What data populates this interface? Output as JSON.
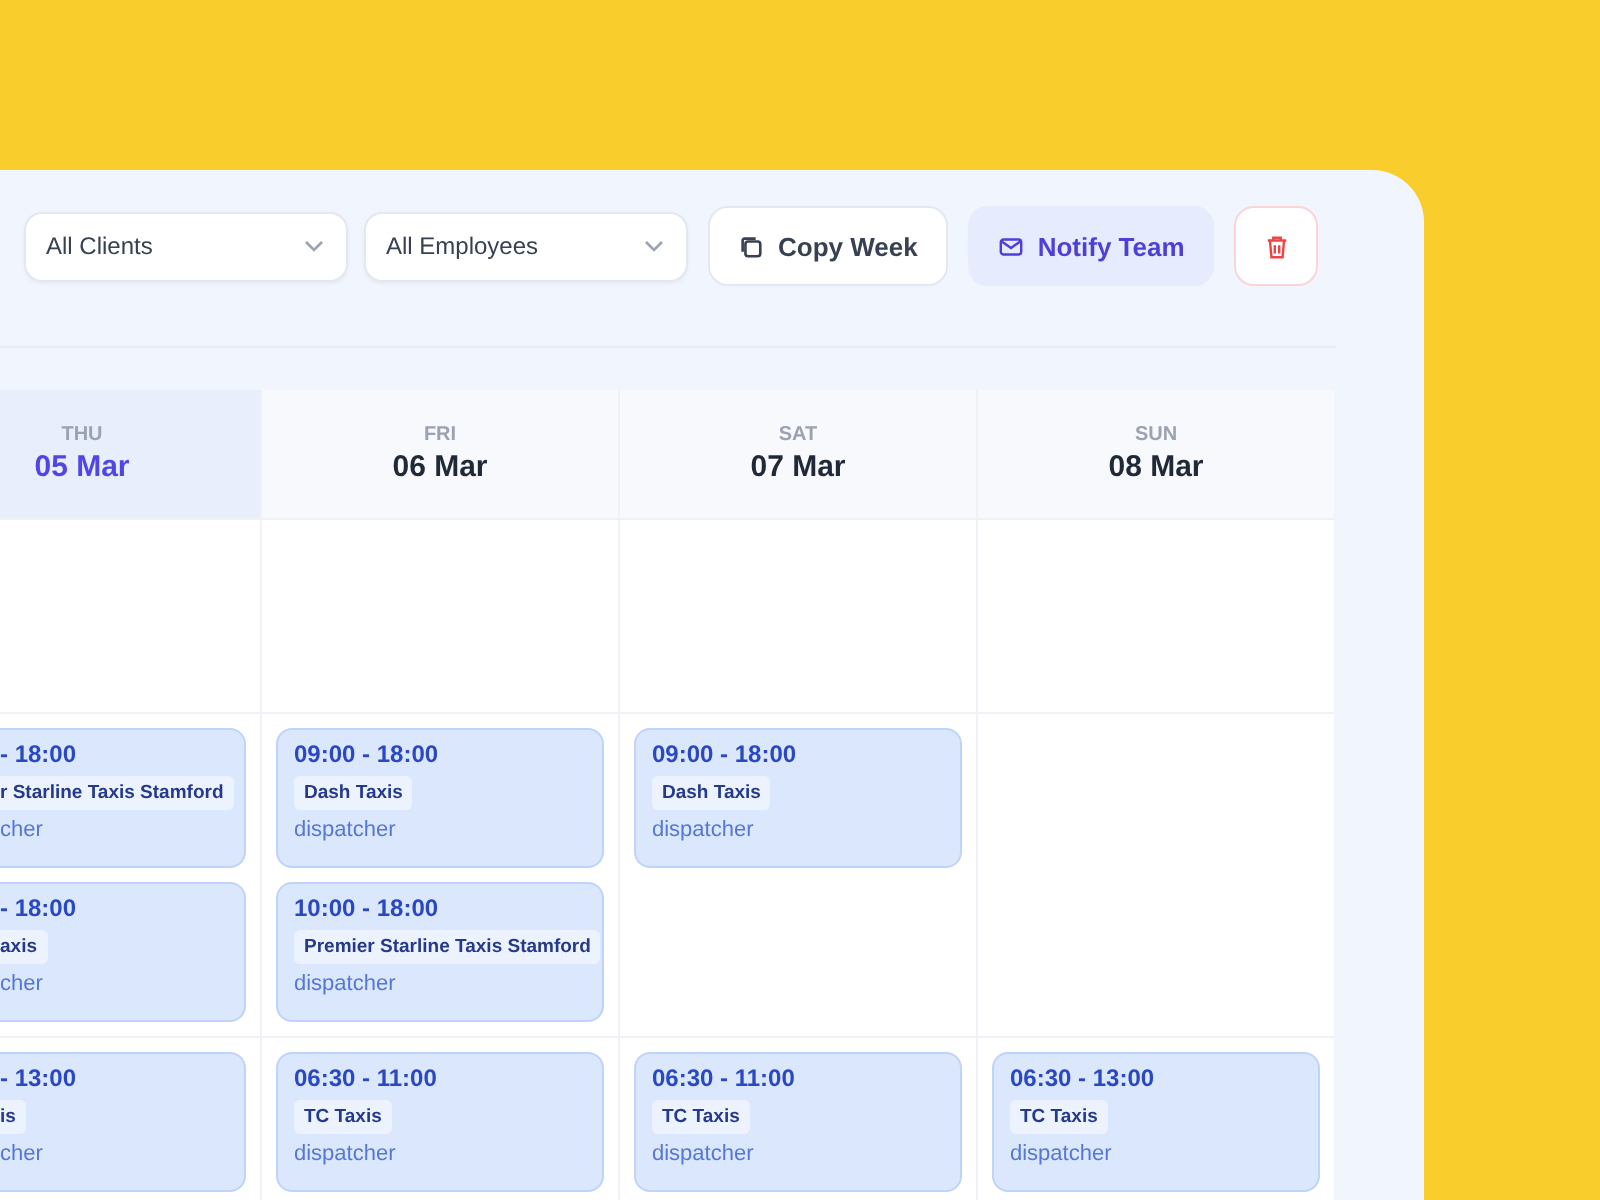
{
  "filters": [
    {
      "value": "All Clients"
    },
    {
      "value": "All Employees"
    }
  ],
  "actions": [
    {
      "kind": "copy",
      "label": "Copy Week"
    },
    {
      "kind": "notify",
      "label": "Notify Team"
    },
    {
      "kind": "delete"
    }
  ],
  "days": [
    {
      "weekday": "THU",
      "date": "05 Mar",
      "selected": true,
      "partial": true
    },
    {
      "weekday": "FRI",
      "date": "06 Mar",
      "selected": false,
      "partial": false
    },
    {
      "weekday": "SAT",
      "date": "07 Mar",
      "selected": false,
      "partial": false
    },
    {
      "weekday": "SUN",
      "date": "08 Mar",
      "selected": false,
      "partial": false
    }
  ],
  "rows": [
    {
      "cells": [
        {},
        {},
        {},
        {}
      ]
    },
    {
      "cells": [
        {
          "shifts": [
            {
              "time": "- 18:00",
              "client": "r Starline Taxis Stamford",
              "role": "cher"
            },
            {
              "time": "- 18:00",
              "client": "axis",
              "role": "cher"
            }
          ]
        },
        {
          "shifts": [
            {
              "time": "09:00 - 18:00",
              "client": "Dash Taxis",
              "role": "dispatcher"
            },
            {
              "time": "10:00 - 18:00",
              "client": "Premier Starline Taxis Stamford",
              "role": "dispatcher"
            }
          ]
        },
        {
          "shifts": [
            {
              "time": "09:00 - 18:00",
              "client": "Dash Taxis",
              "role": "dispatcher"
            }
          ]
        },
        {}
      ]
    },
    {
      "cells": [
        {
          "shifts": [
            {
              "time": "- 13:00",
              "client": "is",
              "role": "cher"
            }
          ]
        },
        {
          "shifts": [
            {
              "time": "06:30 - 11:00",
              "client": "TC Taxis",
              "role": "dispatcher"
            }
          ]
        },
        {
          "shifts": [
            {
              "time": "06:30 - 11:00",
              "client": "TC Taxis",
              "role": "dispatcher"
            }
          ]
        },
        {
          "shifts": [
            {
              "time": "06:30 - 13:00",
              "client": "TC Taxis",
              "role": "dispatcher"
            }
          ]
        }
      ]
    }
  ]
}
